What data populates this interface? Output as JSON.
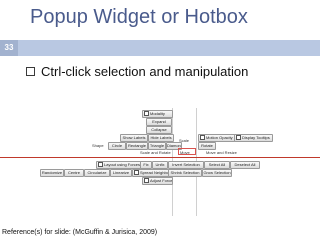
{
  "slide": {
    "title": "Popup Widget or Hotbox",
    "number": "33",
    "bullet": "Ctrl-click selection and manipulation",
    "reference": "Reference(s) for slide: (McGuffin & Jurisica, 2009)"
  },
  "hotbox": {
    "row1": [
      "Modality",
      "Expand"
    ],
    "row2": [
      "Collapse"
    ],
    "row3": [
      "Show Labels",
      "Hide Labels"
    ],
    "row4": [
      "Circle",
      "Rectangle",
      "Triangle",
      "Diamond"
    ],
    "row4_label": "Shape",
    "row5_label": "Scale and Rotate",
    "row5_mid": "Scale",
    "right_row3": [
      "Motion Opacity",
      "Display Tooltips"
    ],
    "right_row4": [
      "Rotate"
    ],
    "move_label": "Move",
    "move_and_resize": "Move and Resize",
    "row6": [
      "Layout using Forces",
      "Fix",
      "Unfix",
      "Invert Selection",
      "Select All",
      "Deselect All"
    ],
    "row7": [
      "Randomize",
      "Centre",
      "Circularize",
      "Linearize",
      "Spread Neighbours",
      "Shrink Selection",
      "Grow Selection"
    ],
    "row8": [
      "Adjust Forces"
    ]
  }
}
